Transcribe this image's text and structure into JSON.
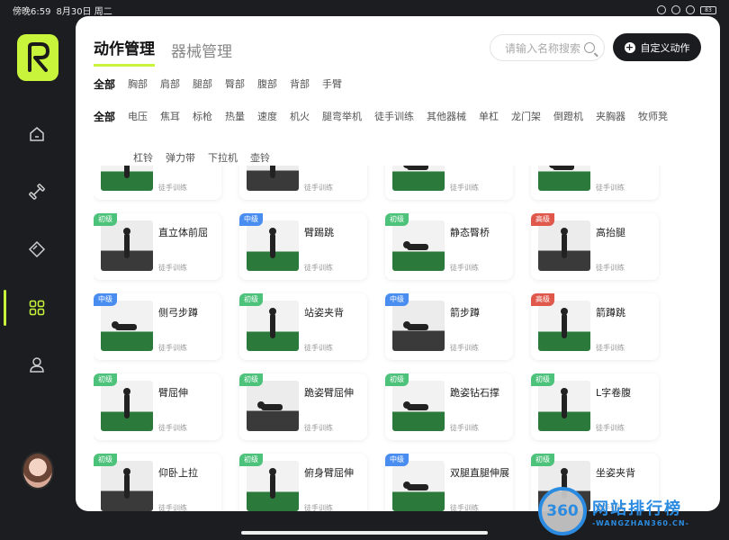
{
  "status_bar": {
    "time": "傍晚6:59",
    "date": "8月30日 周二",
    "battery": "83"
  },
  "sidebar": {
    "items": [
      {
        "icon": "home-icon"
      },
      {
        "icon": "dumbbell-icon"
      },
      {
        "icon": "diamond-icon"
      },
      {
        "icon": "grid-icon",
        "active": true
      },
      {
        "icon": "user-icon"
      }
    ]
  },
  "tabs": [
    {
      "label": "动作管理",
      "active": true
    },
    {
      "label": "器械管理",
      "active": false
    }
  ],
  "search": {
    "placeholder": "请输入名称搜索"
  },
  "custom_button": {
    "label": "自定义动作"
  },
  "body_parts": [
    "全部",
    "胸部",
    "肩部",
    "腿部",
    "臀部",
    "腹部",
    "背部",
    "手臂"
  ],
  "equipment": [
    "全部",
    "电压",
    "焦耳",
    "标枪",
    "热量",
    "速度",
    "机火",
    "腿弯举机",
    "徒手训练",
    "其他器械",
    "单杠",
    "龙门架",
    "倒蹬机",
    "夹胸器",
    "牧师凳",
    "杠铃",
    "弹力带",
    "下拉机",
    "壶铃"
  ],
  "levels": {
    "初级": "#4cc27a",
    "中级": "#4a8df0",
    "高级": "#e0584c"
  },
  "cards": [
    {
      "name": "",
      "category": "徒手训练",
      "level": ""
    },
    {
      "name": "",
      "category": "徒手训练",
      "level": ""
    },
    {
      "name": "",
      "category": "徒手训练",
      "level": ""
    },
    {
      "name": "",
      "category": "徒手训练",
      "level": ""
    },
    {
      "name": "直立体前屈",
      "category": "徒手训练",
      "level": "初级"
    },
    {
      "name": "臂踢跳",
      "category": "徒手训练",
      "level": "中级"
    },
    {
      "name": "静态臀桥",
      "category": "徒手训练",
      "level": "初级"
    },
    {
      "name": "高抬腿",
      "category": "徒手训练",
      "level": "高级"
    },
    {
      "name": "侧弓步蹲",
      "category": "徒手训练",
      "level": "中级"
    },
    {
      "name": "站姿夹背",
      "category": "徒手训练",
      "level": "初级"
    },
    {
      "name": "箭步蹲",
      "category": "徒手训练",
      "level": "中级"
    },
    {
      "name": "箭蹲跳",
      "category": "徒手训练",
      "level": "高级"
    },
    {
      "name": "臂屈伸",
      "category": "徒手训练",
      "level": "初级"
    },
    {
      "name": "跪姿臂屈伸",
      "category": "徒手训练",
      "level": "初级"
    },
    {
      "name": "跪姿钻石撑",
      "category": "徒手训练",
      "level": "初级"
    },
    {
      "name": "L字卷腹",
      "category": "徒手训练",
      "level": "初级"
    },
    {
      "name": "仰卧上拉",
      "category": "徒手训练",
      "level": "初级"
    },
    {
      "name": "俯身臂屈伸",
      "category": "徒手训练",
      "level": "初级"
    },
    {
      "name": "双腿直腿伸展",
      "category": "徒手训练",
      "level": "中级"
    },
    {
      "name": "坐姿夹背",
      "category": "徒手训练",
      "level": "初级"
    }
  ],
  "watermark": {
    "badge": "360",
    "title": "网站排行榜",
    "url": "-WANGZHAN360.CN-"
  }
}
